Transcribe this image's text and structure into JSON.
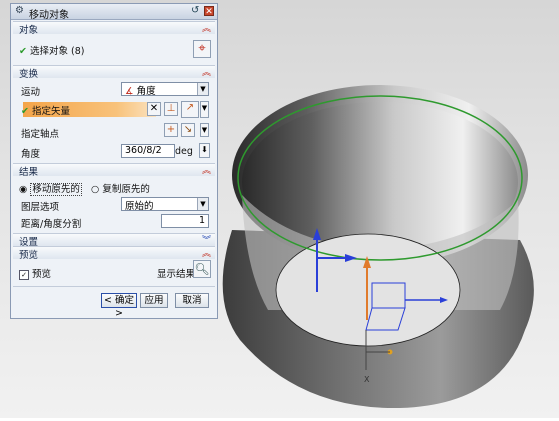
{
  "dialog": {
    "title": "移动对象",
    "sections": {
      "objects": "对象",
      "transform": "变换",
      "result": "结果",
      "settings": "设置",
      "preview": "预览"
    },
    "select_object": "选择对象 (8)",
    "motion_label": "运动",
    "motion_value": "角度",
    "vector_label": "指定矢量",
    "axis_point_label": "指定轴点",
    "angle_label": "角度",
    "angle_value": "360/8/2",
    "angle_unit": "deg",
    "move_original": "移动原先的",
    "copy_original": "复制原先的",
    "layer_option_label": "图层选项",
    "layer_option_value": "原始的",
    "distance_label": "距离/角度分割",
    "distance_value": "1",
    "preview_label": "预览",
    "show_result": "显示结果",
    "ok": "< 确定 >",
    "apply": "应用",
    "cancel": "取消"
  },
  "viewport": {
    "axis_label": "X",
    "colors": {
      "ring": "#2e9a2e",
      "model": "#6f6f6f",
      "z_axis": "#e07b2c",
      "vector": "#2a3fd8"
    }
  }
}
